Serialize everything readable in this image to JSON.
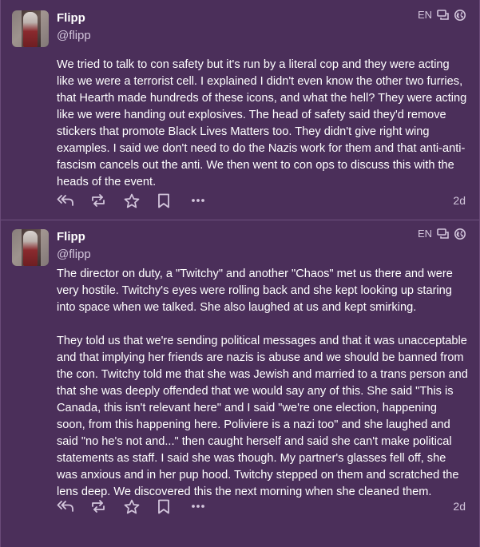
{
  "posts": [
    {
      "display_name": "Flipp",
      "handle": "@flipp",
      "language": "EN",
      "time": "2d",
      "paragraphs": [
        "We tried to talk to con safety but it's run by a literal cop and they were acting like we were a terrorist cell. I explained I didn't even know the other two furries, that Hearth made hundreds of these icons, and what the hell? They were acting like we were handing out explosives. The head of safety said they'd remove stickers that promote Black Lives Matters too. They didn't give right wing examples. I said we don't need to do the Nazis work for them and that anti-anti-fascism cancels out the anti. We then went to con ops to discuss this with the heads of the event."
      ]
    },
    {
      "display_name": "Flipp",
      "handle": "@flipp",
      "language": "EN",
      "time": "2d",
      "paragraphs": [
        "The director on duty, a \"Twitchy\" and another \"Chaos\" met us there and were very hostile. Twitchy's eyes were rolling back and she kept looking up staring into space when we talked. She also laughed at us and kept smirking.",
        "They told us that we're sending political messages and that it was unacceptable and that implying her friends are nazis is abuse and we should be banned from the con. Twitchy told me that she was Jewish and married to a trans person and that she was deeply offended that we would say any of this. She said \"This is Canada, this isn't relevant here\" and I said \"we're one election, happening soon, from this happening here. Poliviere is a nazi too\" and she laughed and said \"no he's not and...\" then caught herself and said she can't make political statements as staff. I said she was though. My partner's glasses fell off, she was anxious and in her pup hood. Twitchy stepped on them and scratched the lens deep. We discovered this the next morning when she cleaned them."
      ]
    }
  ],
  "icons": {
    "reply": "reply-all-icon",
    "boost": "boost-icon",
    "favourite": "star-icon",
    "bookmark": "bookmark-icon",
    "more": "more-icon",
    "thread": "thread-icon",
    "visibility": "globe-icon"
  },
  "colors": {
    "background": "#4b2f5a",
    "text": "#ffffff",
    "secondary_text": "#d3c6dc",
    "divider": "#6f5280"
  }
}
